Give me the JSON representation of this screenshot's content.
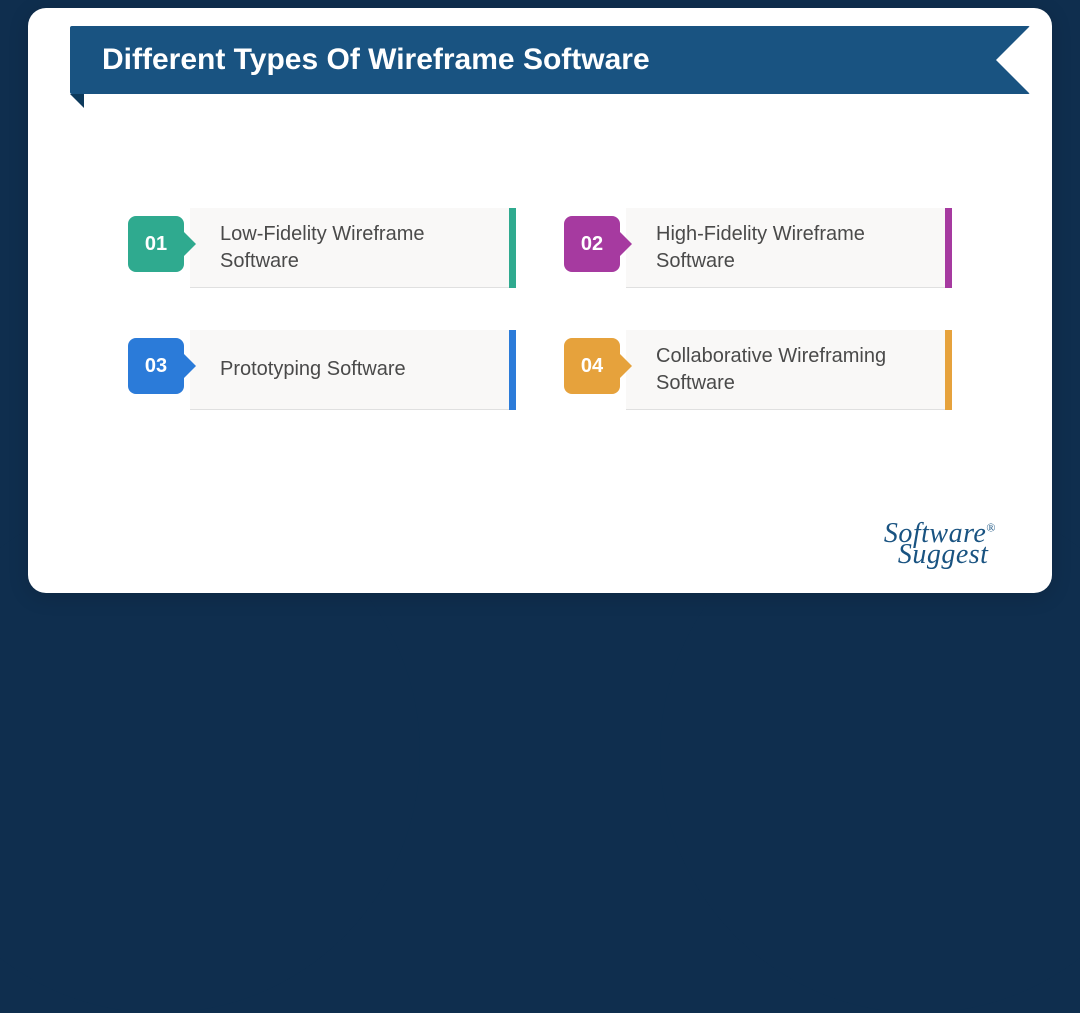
{
  "title": "Different Types Of Wireframe Software",
  "items": [
    {
      "num": "01",
      "label": "Low-Fidelity Wireframe Software",
      "color": "teal"
    },
    {
      "num": "02",
      "label": "High-Fidelity Wireframe Software",
      "color": "purple"
    },
    {
      "num": "03",
      "label": "Prototyping Software",
      "color": "blue"
    },
    {
      "num": "04",
      "label": "Collaborative Wireframing Software",
      "color": "orange"
    }
  ],
  "brand": {
    "line1": "Software",
    "line2": "Suggest",
    "reg": "®"
  },
  "colors": {
    "ribbon": "#195381",
    "teal": "#2faa8f",
    "purple": "#a63aa0",
    "blue": "#2b7bd9",
    "orange": "#e6a23c"
  }
}
